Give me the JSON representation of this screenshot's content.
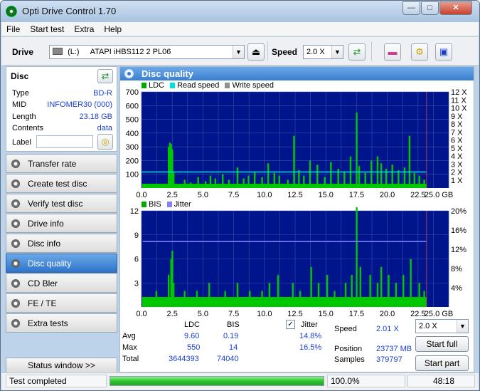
{
  "window": {
    "title": "Opti Drive Control 1.70"
  },
  "menu": [
    "File",
    "Start test",
    "Extra",
    "Help"
  ],
  "toolbar": {
    "drive_label": "Drive",
    "drive_letter": "(L:)",
    "drive_value": "ATAPI iHBS112   2 PL06",
    "speed_label": "Speed",
    "speed_value": "2.0 X"
  },
  "disc": {
    "header": "Disc",
    "props": [
      {
        "label": "Type",
        "value": "BD-R"
      },
      {
        "label": "MID",
        "value": "INFOMER30 (000)"
      },
      {
        "label": "Length",
        "value": "23.18 GB"
      },
      {
        "label": "Contents",
        "value": "data"
      }
    ],
    "label_field": "Label"
  },
  "nav": [
    {
      "label": "Transfer rate",
      "active": false
    },
    {
      "label": "Create test disc",
      "active": false
    },
    {
      "label": "Verify test disc",
      "active": false
    },
    {
      "label": "Drive info",
      "active": false
    },
    {
      "label": "Disc info",
      "active": false
    },
    {
      "label": "Disc quality",
      "active": true
    },
    {
      "label": "CD Bler",
      "active": false
    },
    {
      "label": "FE / TE",
      "active": false
    },
    {
      "label": "Extra tests",
      "active": false
    }
  ],
  "status_window": "Status window >>",
  "panel_title": "Disc quality",
  "legend_top": [
    "LDC",
    "Read speed",
    "Write speed"
  ],
  "legend_bottom": [
    "BIS",
    "Jitter"
  ],
  "colors": {
    "ldc": "#00c800",
    "read": "#00e0e0",
    "write": "#909090",
    "bis": "#00c800",
    "jitter": "#8080ff",
    "plot_bg": "#00148c"
  },
  "chart_data": [
    {
      "type": "bar",
      "xlim": [
        0,
        25
      ],
      "x_ticks": [
        "0.0",
        "2.5",
        "5.0",
        "7.5",
        "10.0",
        "12.5",
        "15.0",
        "17.5",
        "20.0",
        "22.5",
        "25.0 GB"
      ],
      "ylim": [
        0,
        700
      ],
      "y_ticks": [
        "700",
        "600",
        "500",
        "400",
        "300",
        "200",
        "100"
      ],
      "y2_ticks": [
        "12 X",
        "11 X",
        "10 X",
        "9 X",
        "8 X",
        "7 X",
        "6 X",
        "5 X",
        "4 X",
        "3 X",
        "2 X",
        "1 X"
      ],
      "series": [
        {
          "name": "LDC",
          "x": [
            0.5,
            1.0,
            1.5,
            2.2,
            2.3,
            2.4,
            2.5,
            2.6,
            3.5,
            4.0,
            4.6,
            5.2,
            5.6,
            6.0,
            6.6,
            7.1,
            7.8,
            8.3,
            8.7,
            9.2,
            9.8,
            10.3,
            10.8,
            11.2,
            11.9,
            12.4,
            12.8,
            13.2,
            13.7,
            14.3,
            14.9,
            15.4,
            16.0,
            16.5,
            17.0,
            17.5,
            17.7,
            18.2,
            18.7,
            19.2,
            19.5,
            19.9,
            20.4,
            20.9,
            21.4,
            21.8,
            22.2,
            22.6,
            23.0
          ],
          "values": [
            20,
            30,
            25,
            300,
            330,
            320,
            280,
            120,
            60,
            40,
            80,
            50,
            90,
            70,
            100,
            60,
            150,
            70,
            90,
            120,
            80,
            180,
            110,
            90,
            60,
            380,
            130,
            90,
            200,
            170,
            80,
            190,
            140,
            120,
            230,
            550,
            160,
            110,
            200,
            230,
            180,
            140,
            170,
            130,
            150,
            380,
            110,
            90,
            60
          ]
        },
        {
          "name": "Read speed",
          "x": [
            0.0,
            23.2
          ],
          "values": [
            2.0,
            2.0
          ]
        }
      ]
    },
    {
      "type": "bar",
      "xlim": [
        0,
        25
      ],
      "x_ticks": [
        "0.0",
        "2.5",
        "5.0",
        "7.5",
        "10.0",
        "12.5",
        "15.0",
        "17.5",
        "20.0",
        "22.5",
        "25.0 GB"
      ],
      "ylim": [
        0,
        12
      ],
      "y_ticks": [
        "12",
        "9",
        "6",
        "3"
      ],
      "y2_ticks": [
        "20%",
        "16%",
        "12%",
        "8%",
        "4%"
      ],
      "series": [
        {
          "name": "BIS",
          "x": [
            0.5,
            1.2,
            2.2,
            2.4,
            2.5,
            2.6,
            3.5,
            4.5,
            5.5,
            6.8,
            7.8,
            8.8,
            9.8,
            10.4,
            11.1,
            12.3,
            12.9,
            13.8,
            14.4,
            15.1,
            15.7,
            16.6,
            17.1,
            17.5,
            17.8,
            18.6,
            19.2,
            19.5,
            20.1,
            20.7,
            21.3,
            21.9,
            22.6,
            23.0
          ],
          "values": [
            1,
            2,
            4,
            6,
            7,
            3,
            2,
            2,
            3,
            2,
            3,
            2,
            2,
            3,
            4,
            3,
            2,
            5,
            3,
            4,
            2,
            3,
            4,
            14,
            5,
            4,
            3,
            5,
            4,
            3,
            4,
            6,
            3,
            2
          ]
        },
        {
          "name": "Jitter",
          "x": [
            0.1,
            23.2
          ],
          "values": [
            14.8,
            14.8
          ]
        }
      ]
    }
  ],
  "stats": {
    "col_ldc": "LDC",
    "col_bis": "BIS",
    "jitter_label": "Jitter",
    "rows": [
      {
        "label": "Avg",
        "ldc": "9.60",
        "bis": "0.19",
        "jitter": "14.8%"
      },
      {
        "label": "Max",
        "ldc": "550",
        "bis": "14",
        "jitter": "16.5%"
      },
      {
        "label": "Total",
        "ldc": "3644393",
        "bis": "74040",
        "jitter": ""
      }
    ],
    "speed_label": "Speed",
    "speed_value": "2.01 X",
    "position_label": "Position",
    "position_value": "23737 MB",
    "samples_label": "Samples",
    "samples_value": "379797",
    "speed_select": "2.0 X",
    "start_full": "Start full",
    "start_part": "Start part"
  },
  "statusbar": {
    "text": "Test completed",
    "progress": 1.0,
    "percent": "100.0%",
    "time": "48:18"
  }
}
